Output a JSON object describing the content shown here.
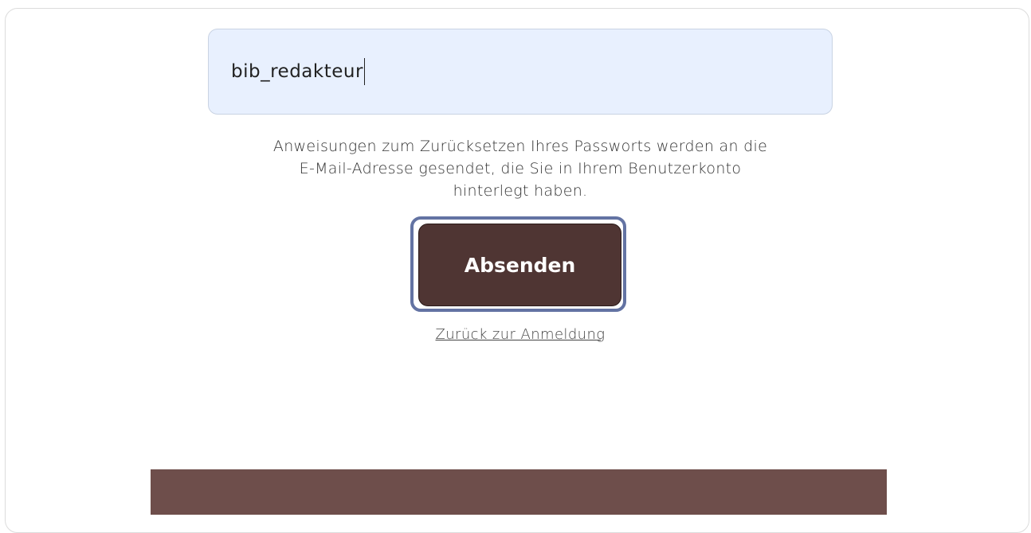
{
  "form": {
    "username_value": "bib_redakteur",
    "hint_line1": "Anweisungen zum Zurücksetzen Ihres Passworts werden an die",
    "hint_line2": "E-Mail-Adresse gesendet, die Sie in Ihrem Benutzerkonto",
    "hint_line3": "hinterlegt haben.",
    "submit_label": "Absenden",
    "back_link_label": "Zurück zur Anmeldung"
  },
  "colors": {
    "input_background": "#e8f0fe",
    "button_background": "#4f3533",
    "focus_ring": "#6373a3",
    "footer": "#6e4e4b"
  }
}
